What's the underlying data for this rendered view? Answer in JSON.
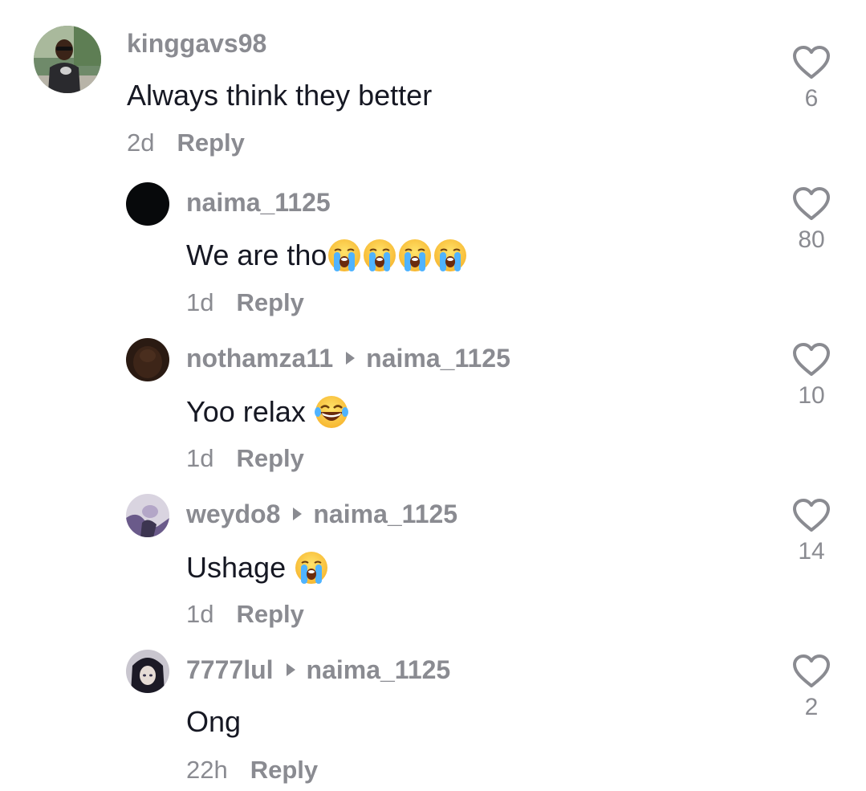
{
  "comments": [
    {
      "username": "kinggavs98",
      "reply_to": "",
      "text": "Always think they better",
      "emojis": [],
      "time": "2d",
      "reply_label": "Reply",
      "likes": "6",
      "avatar": "photo-person-with-sunglasses"
    },
    {
      "username": "naima_1125",
      "reply_to": "",
      "text": "We are tho",
      "emojis": [
        "loudly-crying-face",
        "loudly-crying-face",
        "loudly-crying-face",
        "loudly-crying-face"
      ],
      "time": "1d",
      "reply_label": "Reply",
      "likes": "80",
      "avatar": "black-circle"
    },
    {
      "username": "nothamza11",
      "reply_to": "naima_1125",
      "text": "Yoo relax ",
      "emojis": [
        "face-with-tears-of-joy"
      ],
      "time": "1d",
      "reply_label": "Reply",
      "likes": "10",
      "avatar": "dark-brown-photo"
    },
    {
      "username": "weydo8",
      "reply_to": "naima_1125",
      "text": "Ushage ",
      "emojis": [
        "loudly-crying-face"
      ],
      "time": "1d",
      "reply_label": "Reply",
      "likes": "14",
      "avatar": "purple-anime-photo"
    },
    {
      "username": "7777lul",
      "reply_to": "naima_1125",
      "text": "Ong",
      "emojis": [],
      "time": "22h",
      "reply_label": "Reply",
      "likes": "2",
      "avatar": "dark-anime-character"
    }
  ]
}
